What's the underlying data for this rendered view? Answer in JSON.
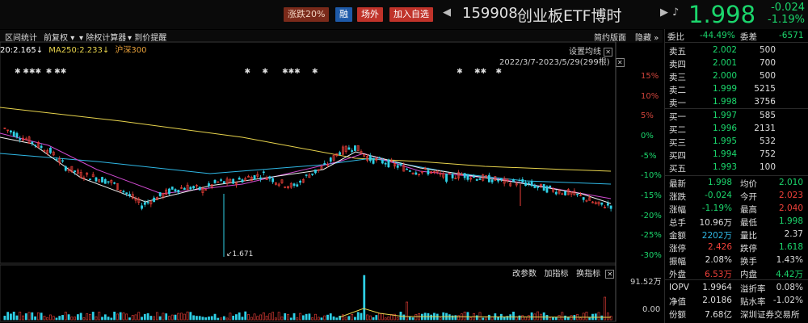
{
  "header": {
    "limit_tag": "涨跌20%",
    "rong_tag": "融",
    "outside_tag": "场外",
    "add_watch": "加入自选",
    "code": "159908",
    "name": "创业板ETF博时",
    "price": "1.998",
    "change": "-0.024",
    "change_pct": "-1.19%",
    "icons": [
      "triangle-left-icon",
      "triangle-right-icon",
      "bell-icon"
    ]
  },
  "toolbar": {
    "interval_stats": "区间统计",
    "adjust": "前复权",
    "dividend_calc": "除权计算器",
    "price_alert": "到价提醒",
    "simple_layout": "简约版面",
    "hide": "隐藏"
  },
  "ma_legend": {
    "ma20": "20:2.165↓",
    "ma250": "MA250:2.233↓",
    "index": "沪深300"
  },
  "chart_controls": {
    "settings": "设置均线",
    "date_range": "2022/3/7-2023/5/29(299根)",
    "low_label": "↙1.671",
    "vol_tools": [
      "改参数",
      "加指标",
      "换指标"
    ],
    "vol_max": "91.52万",
    "vol_min": "0.00"
  },
  "colors": {
    "up": "#f0413a",
    "down": "#1bd66c",
    "cyan": "#2fb8e6",
    "yellow": "#e8d44d"
  },
  "chart_data": {
    "type": "line",
    "pct_ticks": [
      "15%",
      "10%",
      "5%",
      "0%",
      "-5%",
      "-10%",
      "-15%",
      "-20%",
      "-25%",
      "-30%"
    ],
    "ylim": [
      -30,
      15
    ],
    "approx_close": [
      2.5,
      2.45,
      2.4,
      2.35,
      2.25,
      2.2,
      2.18,
      2.15,
      2.08,
      2.0,
      2.05,
      2.1,
      2.12,
      2.1,
      2.15,
      2.15,
      2.18,
      2.2,
      2.15,
      2.12,
      2.2,
      2.25,
      2.35,
      2.38,
      2.3,
      2.28,
      2.25,
      2.22,
      2.22,
      2.18,
      2.2,
      2.18,
      2.17,
      2.15,
      2.15,
      2.12,
      2.1,
      2.08,
      2.05,
      2.0
    ]
  },
  "quote": {
    "weibi_label": "委比",
    "weibi": "-44.49%",
    "weicha_label": "委差",
    "weicha": "-6571",
    "asks": [
      {
        "label": "卖五",
        "price": "2.002",
        "vol": "500"
      },
      {
        "label": "卖四",
        "price": "2.001",
        "vol": "700"
      },
      {
        "label": "卖三",
        "price": "2.000",
        "vol": "500"
      },
      {
        "label": "卖二",
        "price": "1.999",
        "vol": "5215"
      },
      {
        "label": "卖一",
        "price": "1.998",
        "vol": "3756"
      }
    ],
    "bids": [
      {
        "label": "买一",
        "price": "1.997",
        "vol": "585"
      },
      {
        "label": "买二",
        "price": "1.996",
        "vol": "2131"
      },
      {
        "label": "买三",
        "price": "1.995",
        "vol": "532"
      },
      {
        "label": "买四",
        "price": "1.994",
        "vol": "752"
      },
      {
        "label": "买五",
        "price": "1.993",
        "vol": "100"
      }
    ],
    "stats": [
      {
        "l1": "最新",
        "v1": "1.998",
        "c1": "g",
        "l2": "均价",
        "v2": "2.010",
        "c2": "g"
      },
      {
        "l1": "涨跌",
        "v1": "-0.024",
        "c1": "g",
        "l2": "今开",
        "v2": "2.023",
        "c2": "r"
      },
      {
        "l1": "涨幅",
        "v1": "-1.19%",
        "c1": "g",
        "l2": "最高",
        "v2": "2.040",
        "c2": "r"
      },
      {
        "l1": "总手",
        "v1": "10.96万",
        "c1": "w",
        "l2": "最低",
        "v2": "1.998",
        "c2": "g"
      },
      {
        "l1": "金额",
        "v1": "2202万",
        "c1": "b",
        "l2": "量比",
        "v2": "2.37",
        "c2": "w"
      },
      {
        "l1": "涨停",
        "v1": "2.426",
        "c1": "r",
        "l2": "跌停",
        "v2": "1.618",
        "c2": "g"
      },
      {
        "l1": "振幅",
        "v1": "2.08%",
        "c1": "w",
        "l2": "换手",
        "v2": "1.43%",
        "c2": "w"
      },
      {
        "l1": "外盘",
        "v1": "6.53万",
        "c1": "r",
        "l2": "内盘",
        "v2": "4.42万",
        "c2": "g"
      }
    ],
    "extra": [
      {
        "l1": "IOPV",
        "v1": "1.9964",
        "l2": "溢折率",
        "v2": "0.08%"
      },
      {
        "l1": "净值",
        "v1": "2.0186",
        "l2": "贴水率",
        "v2": "-1.02%"
      },
      {
        "l1": "份额",
        "v1": "7.68亿",
        "l2": "深圳证券交易所",
        "v2": ""
      }
    ]
  }
}
